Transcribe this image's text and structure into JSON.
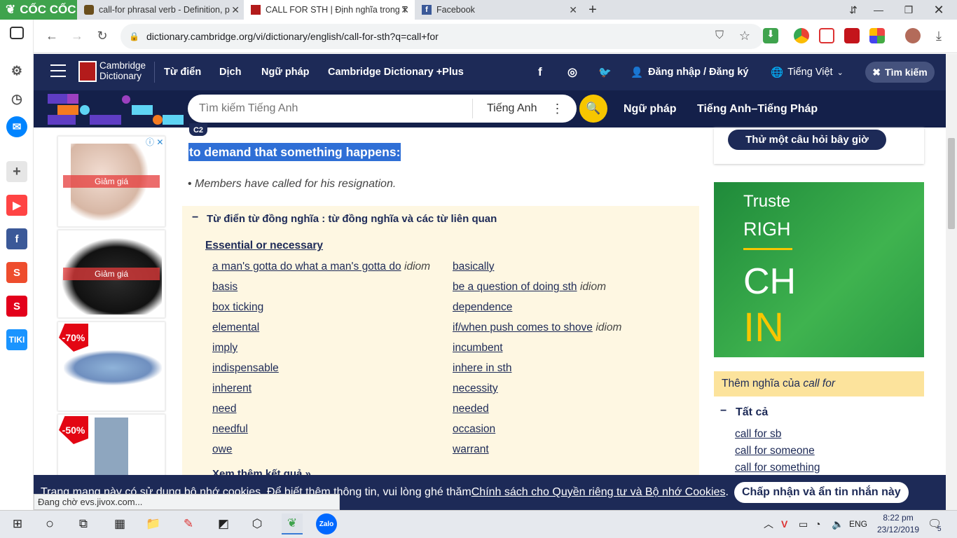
{
  "browser": {
    "brand": "CỐC CỐC",
    "tabs": [
      {
        "title": "call-for phrasal verb - Definition, p"
      },
      {
        "title": "CALL FOR STH | Định nghĩa trong T"
      },
      {
        "title": "Facebook"
      }
    ],
    "url": "dictionary.cambridge.org/vi/dictionary/english/call-for-sth?q=call+for",
    "status_text": "Đang chờ evs.jivox.com..."
  },
  "site": {
    "logo_line1": "Cambridge",
    "logo_line2": "Dictionary",
    "nav": [
      "Từ điển",
      "Dịch",
      "Ngữ pháp",
      "Cambridge Dictionary +Plus"
    ],
    "login": "Đăng nhập / Đăng ký",
    "language": "Tiếng Việt",
    "search_close": "Tìm kiếm",
    "search_placeholder": "Tìm kiếm Tiếng Anh",
    "search_lang": "Tiếng Anh",
    "sub_nav": [
      "Ngữ pháp",
      "Tiếng Anh–Tiếng Pháp"
    ]
  },
  "entry": {
    "level": "C2",
    "definition": "to demand that something happens:",
    "example": "Members have called for his resignation."
  },
  "synonyms": {
    "header": "Từ điển từ đồng nghĩa : từ đồng nghĩa và các từ liên quan",
    "group": "Essential or necessary",
    "col1": [
      {
        "word": "a man's gotta do what a man's gotta do",
        "tag": "idiom"
      },
      {
        "word": "basis",
        "tag": ""
      },
      {
        "word": "box ticking",
        "tag": ""
      },
      {
        "word": "elemental",
        "tag": ""
      },
      {
        "word": "imply",
        "tag": ""
      },
      {
        "word": "indispensable",
        "tag": ""
      },
      {
        "word": "inherent",
        "tag": ""
      },
      {
        "word": "need",
        "tag": ""
      },
      {
        "word": "needful",
        "tag": ""
      },
      {
        "word": "owe",
        "tag": ""
      }
    ],
    "col2": [
      {
        "word": "basically",
        "tag": ""
      },
      {
        "word": "be a question of doing sth",
        "tag": "idiom"
      },
      {
        "word": "dependence",
        "tag": ""
      },
      {
        "word": "if/when push comes to shove",
        "tag": "idiom"
      },
      {
        "word": "incumbent",
        "tag": ""
      },
      {
        "word": "inhere in sth",
        "tag": ""
      },
      {
        "word": "necessity",
        "tag": ""
      },
      {
        "word": "needed",
        "tag": ""
      },
      {
        "word": "occasion",
        "tag": ""
      },
      {
        "word": "warrant",
        "tag": ""
      }
    ],
    "more": "Xem thêm kết quả »"
  },
  "ads": {
    "sale_label": "Giảm giá",
    "discount1": "-70%",
    "discount2": "-50%"
  },
  "right": {
    "quiz_button": "Thử một câu hỏi bây giờ",
    "banner": {
      "l1": "Truste",
      "l2": "RIGH",
      "l3": "CH",
      "l4": "IN"
    },
    "more_title_prefix": "Thêm nghĩa của ",
    "more_title_word": "call for",
    "all_label": "Tất cả",
    "links": [
      "call for sb",
      "call for someone",
      "call for something"
    ]
  },
  "cookie": {
    "text": "Trang mạng này có sử dụng bộ nhớ cookies. Để biết thêm thông tin, vui lòng ghé thăm ",
    "link": "Chính sách cho Quyền riêng tư và Bộ nhớ Cookies",
    "period": ".",
    "button": "Chấp nhận và ẩn tin nhắn này"
  },
  "taskbar": {
    "lang": "ENG",
    "time": "8:22 pm",
    "date": "23/12/2019",
    "notif_count": "5"
  },
  "colors": {
    "navy": "#1d2a57",
    "highlight": "#2f6fd6",
    "synonym_bg": "#fef7e2",
    "coc_green": "#3fa34d",
    "search_yellow": "#f7c600"
  }
}
